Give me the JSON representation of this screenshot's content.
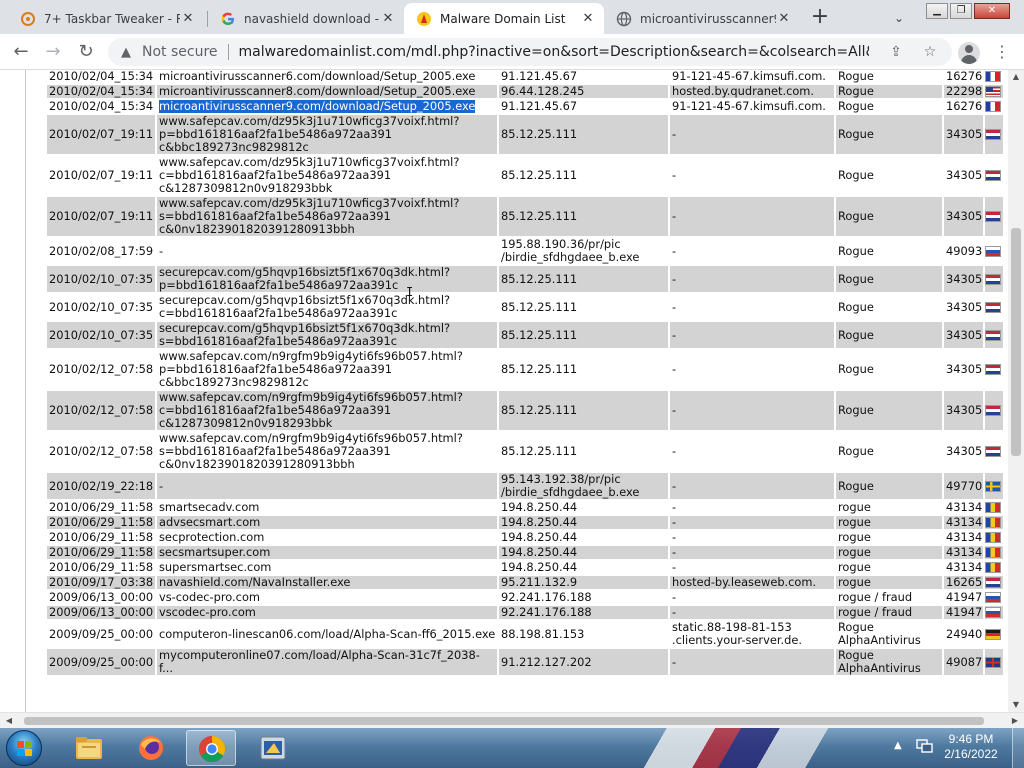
{
  "browser": {
    "tabs": [
      {
        "label": "7+ Taskbar Tweaker - Ra",
        "icon": "taskbar-tweaker-icon"
      },
      {
        "label": "navashield download - G",
        "icon": "google-icon"
      },
      {
        "label": "Malware Domain List",
        "icon": "shell-favicon-icon"
      },
      {
        "label": "microantivirusscanner9.c",
        "icon": "globe-icon"
      }
    ],
    "address": {
      "security_label": "Not secure",
      "url": "malwaredomainlist.com/mdl.php?inactive=on&sort=Description&search=&colsearch=All&ascordesc=A..."
    }
  },
  "table": {
    "rows": [
      {
        "date": "2010/02/04_15:34",
        "domain": [
          "microantivirusscanner6.com/download/Setup_2005.exe"
        ],
        "ip": [
          "91.121.45.67"
        ],
        "reverse": [
          "91-121-45-67.kimsufi.com."
        ],
        "desc": [
          "Rogue"
        ],
        "asn": "16276",
        "flag": "fr",
        "shade": "w",
        "highlight": false
      },
      {
        "date": "2010/02/04_15:34",
        "domain": [
          "microantivirusscanner8.com/download/Setup_2005.exe"
        ],
        "ip": [
          "96.44.128.245"
        ],
        "reverse": [
          "hosted.by.qudranet.com."
        ],
        "desc": [
          "Rogue"
        ],
        "asn": "22298",
        "flag": "us",
        "shade": "g",
        "highlight": false
      },
      {
        "date": "2010/02/04_15:34",
        "domain": [
          "microantivirusscanner9.com/download/Setup_2005.exe"
        ],
        "ip": [
          "91.121.45.67"
        ],
        "reverse": [
          "91-121-45-67.kimsufi.com."
        ],
        "desc": [
          "Rogue"
        ],
        "asn": "16276",
        "flag": "fr",
        "shade": "w",
        "highlight": true
      },
      {
        "date": "2010/02/07_19:11",
        "domain": [
          "www.safepcav.com/dz95k3j1u710wficg37voixf.html?",
          "p=bbd161816aaf2fa1be5486a972aa391",
          "c&bbc189273nc9829812c"
        ],
        "ip": [
          "85.12.25.111"
        ],
        "reverse": [
          "-"
        ],
        "desc": [
          "Rogue"
        ],
        "asn": "34305",
        "flag": "nl",
        "shade": "g",
        "highlight": false
      },
      {
        "date": "2010/02/07_19:11",
        "domain": [
          "www.safepcav.com/dz95k3j1u710wficg37voixf.html?",
          "c=bbd161816aaf2fa1be5486a972aa391",
          "c&1287309812n0v918293bbk"
        ],
        "ip": [
          "85.12.25.111"
        ],
        "reverse": [
          "-"
        ],
        "desc": [
          "Rogue"
        ],
        "asn": "34305",
        "flag": "nl",
        "shade": "w",
        "highlight": false
      },
      {
        "date": "2010/02/07_19:11",
        "domain": [
          "www.safepcav.com/dz95k3j1u710wficg37voixf.html?",
          "s=bbd161816aaf2fa1be5486a972aa391",
          "c&0nv1823901820391280913bbh"
        ],
        "ip": [
          "85.12.25.111"
        ],
        "reverse": [
          "-"
        ],
        "desc": [
          "Rogue"
        ],
        "asn": "34305",
        "flag": "nl",
        "shade": "g",
        "highlight": false
      },
      {
        "date": "2010/02/08_17:59",
        "domain": [
          "-"
        ],
        "ip": [
          "195.88.190.36/pr/pic",
          "/birdie_sfdhgdaee_b.exe"
        ],
        "reverse": [
          "-"
        ],
        "desc": [
          "Rogue"
        ],
        "asn": "49093",
        "flag": "ru",
        "shade": "w",
        "highlight": false
      },
      {
        "date": "2010/02/10_07:35",
        "domain": [
          "securepcav.com/g5hqvp16bsizt5f1x670q3dk.html?",
          "p=bbd161816aaf2fa1be5486a972aa391c"
        ],
        "ip": [
          "85.12.25.111"
        ],
        "reverse": [
          "-"
        ],
        "desc": [
          "Rogue"
        ],
        "asn": "34305",
        "flag": "nl",
        "shade": "g",
        "highlight": false
      },
      {
        "date": "2010/02/10_07:35",
        "domain": [
          "securepcav.com/g5hqvp16bsizt5f1x670q3dk.html?",
          "c=bbd161816aaf2fa1be5486a972aa391c"
        ],
        "ip": [
          "85.12.25.111"
        ],
        "reverse": [
          "-"
        ],
        "desc": [
          "Rogue"
        ],
        "asn": "34305",
        "flag": "nl",
        "shade": "w",
        "highlight": false
      },
      {
        "date": "2010/02/10_07:35",
        "domain": [
          "securepcav.com/g5hqvp16bsizt5f1x670q3dk.html?",
          "s=bbd161816aaf2fa1be5486a972aa391c"
        ],
        "ip": [
          "85.12.25.111"
        ],
        "reverse": [
          "-"
        ],
        "desc": [
          "Rogue"
        ],
        "asn": "34305",
        "flag": "nl",
        "shade": "g",
        "highlight": false
      },
      {
        "date": "2010/02/12_07:58",
        "domain": [
          "www.safepcav.com/n9rgfm9b9ig4yti6fs96b057.html?",
          "p=bbd161816aaf2fa1be5486a972aa391",
          "c&bbc189273nc9829812c"
        ],
        "ip": [
          "85.12.25.111"
        ],
        "reverse": [
          "-"
        ],
        "desc": [
          "Rogue"
        ],
        "asn": "34305",
        "flag": "nl",
        "shade": "w",
        "highlight": false
      },
      {
        "date": "2010/02/12_07:58",
        "domain": [
          "www.safepcav.com/n9rgfm9b9ig4yti6fs96b057.html?",
          "c=bbd161816aaf2fa1be5486a972aa391",
          "c&1287309812n0v918293bbk"
        ],
        "ip": [
          "85.12.25.111"
        ],
        "reverse": [
          "-"
        ],
        "desc": [
          "Rogue"
        ],
        "asn": "34305",
        "flag": "nl",
        "shade": "g",
        "highlight": false
      },
      {
        "date": "2010/02/12_07:58",
        "domain": [
          "www.safepcav.com/n9rgfm9b9ig4yti6fs96b057.html?",
          "s=bbd161816aaf2fa1be5486a972aa391",
          "c&0nv1823901820391280913bbh"
        ],
        "ip": [
          "85.12.25.111"
        ],
        "reverse": [
          "-"
        ],
        "desc": [
          "Rogue"
        ],
        "asn": "34305",
        "flag": "nl",
        "shade": "w",
        "highlight": false
      },
      {
        "date": "2010/02/19_22:18",
        "domain": [
          "-"
        ],
        "ip": [
          "95.143.192.38/pr/pic",
          "/birdie_sfdhgdaee_b.exe"
        ],
        "reverse": [
          "-"
        ],
        "desc": [
          "Rogue"
        ],
        "asn": "49770",
        "flag": "se",
        "shade": "g",
        "highlight": false
      },
      {
        "date": "2010/06/29_11:58",
        "domain": [
          "smartsecadv.com"
        ],
        "ip": [
          "194.8.250.44"
        ],
        "reverse": [
          "-"
        ],
        "desc": [
          "rogue"
        ],
        "asn": "43134",
        "flag": "md",
        "shade": "w",
        "highlight": false
      },
      {
        "date": "2010/06/29_11:58",
        "domain": [
          "advsecsmart.com"
        ],
        "ip": [
          "194.8.250.44"
        ],
        "reverse": [
          "-"
        ],
        "desc": [
          "rogue"
        ],
        "asn": "43134",
        "flag": "md",
        "shade": "g",
        "highlight": false
      },
      {
        "date": "2010/06/29_11:58",
        "domain": [
          "secprotection.com"
        ],
        "ip": [
          "194.8.250.44"
        ],
        "reverse": [
          "-"
        ],
        "desc": [
          "rogue"
        ],
        "asn": "43134",
        "flag": "md",
        "shade": "w",
        "highlight": false
      },
      {
        "date": "2010/06/29_11:58",
        "domain": [
          "secsmartsuper.com"
        ],
        "ip": [
          "194.8.250.44"
        ],
        "reverse": [
          "-"
        ],
        "desc": [
          "rogue"
        ],
        "asn": "43134",
        "flag": "md",
        "shade": "g",
        "highlight": false
      },
      {
        "date": "2010/06/29_11:58",
        "domain": [
          "supersmartsec.com"
        ],
        "ip": [
          "194.8.250.44"
        ],
        "reverse": [
          "-"
        ],
        "desc": [
          "rogue"
        ],
        "asn": "43134",
        "flag": "md",
        "shade": "w",
        "highlight": false
      },
      {
        "date": "2010/09/17_03:38",
        "domain": [
          "navashield.com/NavaInstaller.exe"
        ],
        "ip": [
          "95.211.132.9"
        ],
        "reverse": [
          "hosted-by.leaseweb.com."
        ],
        "desc": [
          "rogue"
        ],
        "asn": "16265",
        "flag": "nl",
        "shade": "g",
        "highlight": false
      },
      {
        "date": "2009/06/13_00:00",
        "domain": [
          "vs-codec-pro.com"
        ],
        "ip": [
          "92.241.176.188"
        ],
        "reverse": [
          "-"
        ],
        "desc": [
          "rogue / fraud"
        ],
        "asn": "41947",
        "flag": "ru",
        "shade": "w",
        "highlight": false
      },
      {
        "date": "2009/06/13_00:00",
        "domain": [
          "vscodec-pro.com"
        ],
        "ip": [
          "92.241.176.188"
        ],
        "reverse": [
          "-"
        ],
        "desc": [
          "rogue / fraud"
        ],
        "asn": "41947",
        "flag": "ru",
        "shade": "g",
        "highlight": false
      },
      {
        "date": "2009/09/25_00:00",
        "domain": [
          "computeron-linescan06.com/load/Alpha-Scan-ff6_2015.exe"
        ],
        "ip": [
          "88.198.81.153"
        ],
        "reverse": [
          "static.88-198-81-153",
          ".clients.your-server.de."
        ],
        "desc": [
          "Rogue",
          "AlphaAntivirus"
        ],
        "asn": "24940",
        "flag": "de",
        "shade": "w",
        "highlight": false
      },
      {
        "date": "2009/09/25_00:00",
        "domain": [
          "mycomputeronline07.com/load/Alpha-Scan-31c7f_2038-",
          "f..."
        ],
        "ip": [
          "91.212.127.202"
        ],
        "reverse": [
          "-"
        ],
        "desc": [
          "Rogue",
          "AlphaAntivirus"
        ],
        "asn": "49087",
        "flag": "gb",
        "shade": "g",
        "highlight": false
      }
    ]
  },
  "taskbar": {
    "items": [
      {
        "name": "file-explorer-icon"
      },
      {
        "name": "firefox-icon"
      },
      {
        "name": "chrome-icon"
      },
      {
        "name": "app-tool-icon"
      }
    ],
    "clock": {
      "time": "9:46 PM",
      "date": "2/16/2022"
    }
  }
}
